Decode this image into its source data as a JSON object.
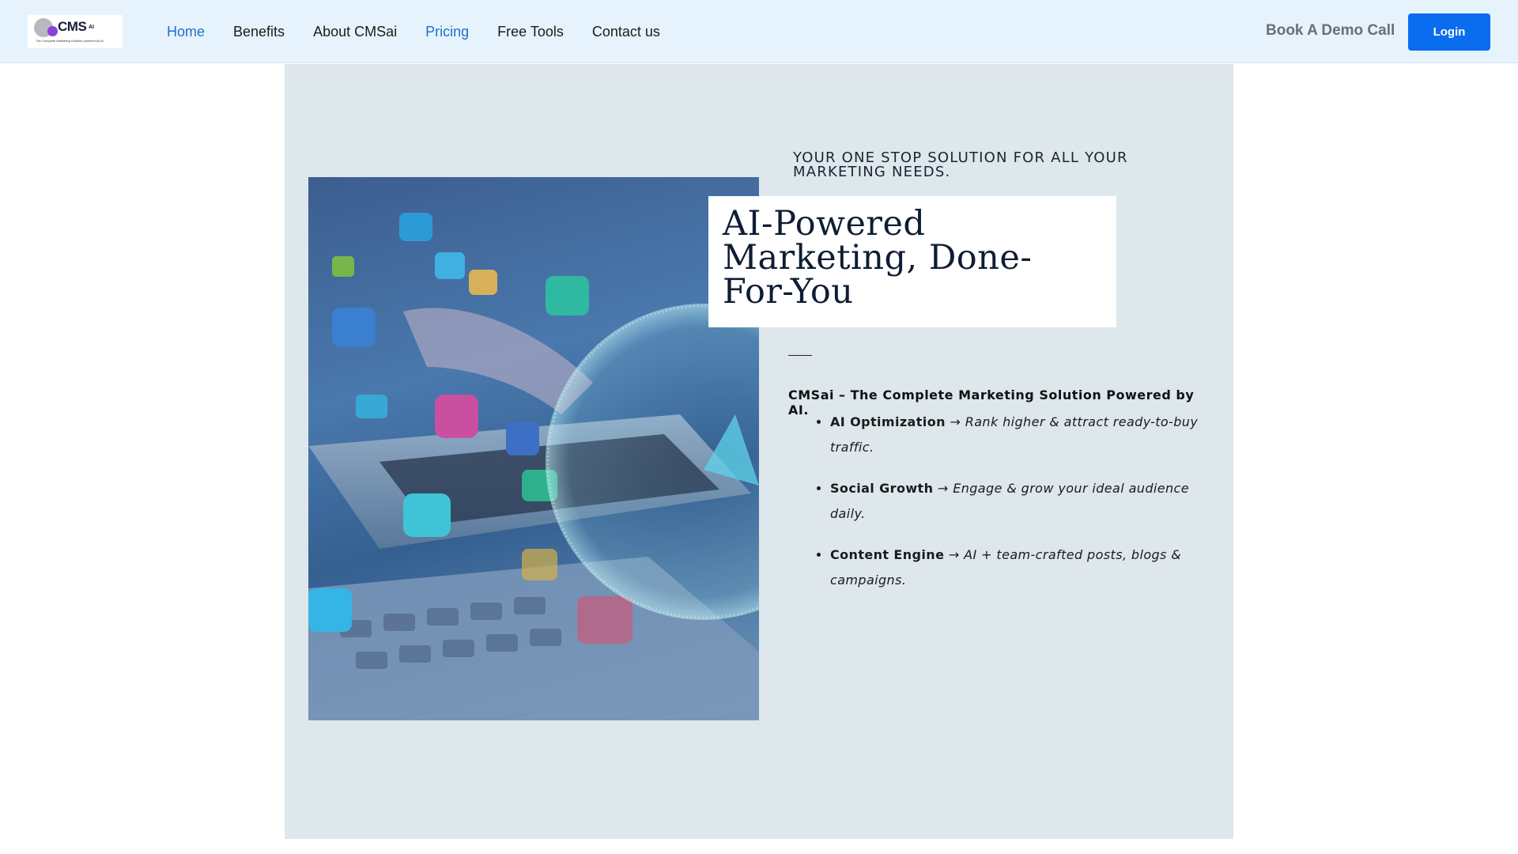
{
  "brand": {
    "logo_word": "CMS",
    "logo_suffix": "AI",
    "logo_tagline": "The Complete Marketing Solution powered by AI"
  },
  "nav": {
    "items": [
      {
        "label": "Home",
        "active": true
      },
      {
        "label": "Benefits",
        "active": false
      },
      {
        "label": "About CMSai",
        "active": false
      },
      {
        "label": "Pricing",
        "active": true
      },
      {
        "label": "Free Tools",
        "active": false
      },
      {
        "label": "Contact us",
        "active": false
      }
    ],
    "demo_label": "Book A Demo Call",
    "login_label": "Login"
  },
  "hero": {
    "eyebrow": "YOUR ONE STOP SOLUTION FOR ALL YOUR MARKETING NEEDS.",
    "title": "AI-Powered Marketing, Done-For-You",
    "lead": "CMSai – The Complete Marketing Solution Powered by AI.",
    "features": [
      {
        "name": "AI Optimization",
        "arrow": "→",
        "desc": "Rank higher & attract ready-to-buy traffic."
      },
      {
        "name": "Social Growth",
        "arrow": "→",
        "desc": "Engage & grow your ideal audience daily."
      },
      {
        "name": "Content Engine",
        "arrow": "→",
        "desc": "AI + team-crafted posts, blogs & campaigns."
      }
    ]
  },
  "colors": {
    "header_bg": "#e6f3fc",
    "accent": "#0a6df0",
    "nav_active": "#1e6fd0",
    "hero_bg": "#dde7ec"
  }
}
